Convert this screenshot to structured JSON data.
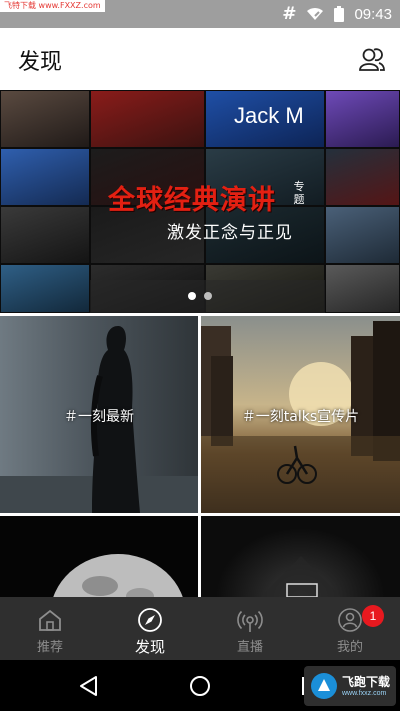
{
  "status_bar": {
    "watermark": "飞特下载 www.FXXZ.com",
    "hash": "#",
    "time": "09:43"
  },
  "header": {
    "title": "发现"
  },
  "banner": {
    "title": "全球经典演讲",
    "tag": "专题",
    "subtitle": "激发正念与正见",
    "poster_text": "Jack M"
  },
  "tiles": [
    {
      "label": "＃一刻最新"
    },
    {
      "label": "＃一刻talks宣传片"
    }
  ],
  "bottom_nav": {
    "items": [
      {
        "label": "推荐"
      },
      {
        "label": "发现"
      },
      {
        "label": "直播"
      },
      {
        "label": "我的",
        "badge": "1"
      }
    ]
  },
  "watermark2": {
    "text": "飞跑下载",
    "sub": "www.fxxz.com"
  }
}
